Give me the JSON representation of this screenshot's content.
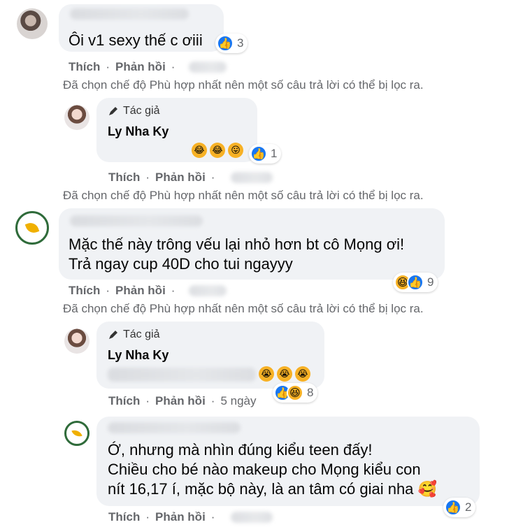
{
  "labels": {
    "like": "Thích",
    "reply": "Phản hồi",
    "sep": "·",
    "author": "Tác giả",
    "filter_note": "Đã chọn chế độ Phù hợp nhất nên một số câu trả lời có thể bị lọc ra."
  },
  "comments": [
    {
      "text_lines": [
        "Ôi v1 sexy thế c ơiii"
      ],
      "reaction_count": "3",
      "reactions": [
        "like"
      ]
    },
    {
      "author_badge": "Tác giả",
      "author": "Ly Nha Ky",
      "reaction_count": "1",
      "reactions": [
        "like"
      ]
    },
    {
      "text_lines": [
        "Mặc thế này trông vếu lại nhỏ hơn bt cô Mọng ơi!",
        "Trả ngay cup 40D cho tui ngayyy"
      ],
      "reaction_count": "9",
      "reactions": [
        "haha",
        "like"
      ]
    },
    {
      "author_badge": "Tác giả",
      "author": "Ly Nha Ky",
      "reaction_count": "8",
      "time": "5 ngày",
      "reactions": [
        "like",
        "haha"
      ]
    },
    {
      "text_lines": [
        "Ớ, nhưng mà nhìn đúng kiểu teen đấy!",
        "Chiều cho bé nào makeup cho Mọng kiểu con",
        "nít 16,17 í, mặc bộ này, là an tâm có giai nha 🥰"
      ],
      "reaction_count": "2",
      "reactions": [
        "like"
      ]
    }
  ],
  "icons": [
    "pen-icon",
    "like-icon",
    "haha-icon",
    "sad-icon"
  ],
  "colors": {
    "bubble": "#f0f2f5",
    "like_blue": "#1877f2",
    "meta_gray": "#65676b"
  }
}
